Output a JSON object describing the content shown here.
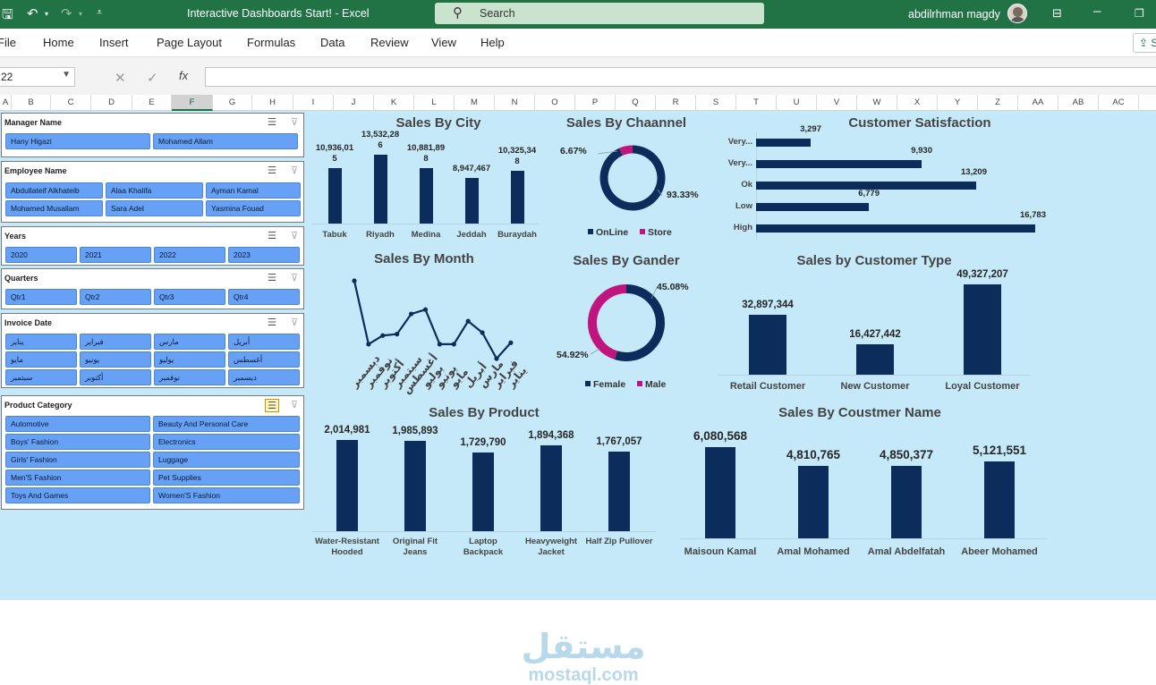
{
  "titlebar": {
    "doc_title": "Interactive Dashboards Start!  -  Excel",
    "search_placeholder": "Search",
    "user_name": "abdilrhman magdy",
    "accent_color": "#217346",
    "icons": [
      "save-icon",
      "undo-icon",
      "redo-icon",
      "customize-qat-icon",
      "ribbon-display-icon",
      "restore-icon"
    ]
  },
  "ribbon": {
    "tabs": [
      "File",
      "Home",
      "Insert",
      "Page Layout",
      "Formulas",
      "Data",
      "Review",
      "View",
      "Help"
    ],
    "share_label": "S"
  },
  "formula_bar": {
    "name_box": "22",
    "formula": ""
  },
  "columns": [
    "A",
    "B",
    "C",
    "D",
    "E",
    "F",
    "G",
    "H",
    "I",
    "J",
    "K",
    "L",
    "M",
    "N",
    "O",
    "P",
    "Q",
    "R",
    "S",
    "T",
    "U",
    "V",
    "W",
    "X",
    "Y",
    "Z",
    "AA",
    "AB",
    "AC"
  ],
  "selected_column": "F",
  "slicers": {
    "manager": {
      "title": "Manager Name",
      "items": [
        "Hany Higazi",
        "Mohamed Allam"
      ]
    },
    "employee": {
      "title": "Employee Name",
      "items": [
        "Abdullateif Alkhateib",
        "Alaa Khalifa",
        "Ayman Kamal",
        "Mohamed Musallam",
        "Sara Adel",
        "Yasmina Fouad"
      ]
    },
    "years": {
      "title": "Years",
      "items": [
        "2020",
        "2021",
        "2022",
        "2023"
      ]
    },
    "quarters": {
      "title": "Quarters",
      "items": [
        "Qtr1",
        "Qtr2",
        "Qtr3",
        "Qtr4"
      ]
    },
    "invoice_date": {
      "title": "Invoice Date",
      "items": [
        "يناير",
        "فبراير",
        "مارس",
        "أبريل",
        "مايو",
        "يونيو",
        "يوليو",
        "أغسطس",
        "سبتمبر",
        "أكتوبر",
        "نوفمبر",
        "ديسمبر"
      ]
    },
    "category": {
      "title": "Product Category",
      "items": [
        "Automotive",
        "Beauty And Personal Care",
        "Boys' Fashion",
        "Electronics",
        "Girls' Fashion",
        "Luggage",
        "Men'S Fashion",
        "Pet Supplies",
        "Toys And Games",
        "Women'S Fashion"
      ]
    }
  },
  "chart_data": [
    {
      "id": "city",
      "type": "bar",
      "title": "Sales By City",
      "categories": [
        "Tabuk",
        "Riyadh",
        "Medina",
        "Jeddah",
        "Buraydah"
      ],
      "values": [
        10936015,
        13532286,
        10881898,
        8947467,
        10325348
      ],
      "labels": [
        "10,936,01\n5",
        "13,532,28\n6",
        "10,881,89\n8",
        "8,947,467",
        "10,325,34\n8"
      ]
    },
    {
      "id": "channel",
      "type": "pie",
      "title": "Sales By Chaannel",
      "categories": [
        "OnLine",
        "Store"
      ],
      "values": [
        93.33,
        6.67
      ],
      "labels": [
        "93.33%",
        "6.67%"
      ],
      "colors": [
        "#0c2c5c",
        "#c0157f"
      ],
      "legend": "bottom"
    },
    {
      "id": "satisfaction",
      "type": "bar",
      "orientation": "horizontal",
      "title": "Customer Satisfaction",
      "categories": [
        "Very...",
        "Very...",
        "Ok",
        "Low",
        "High"
      ],
      "values": [
        3297,
        9930,
        13209,
        6779,
        16783
      ],
      "labels": [
        "3,297",
        "9,930",
        "13,209",
        "6,779",
        "16,783"
      ]
    },
    {
      "id": "month",
      "type": "line",
      "title": "Sales By Month",
      "categories": [
        "ديسمبر",
        "نوفمبر",
        "أكتوبر",
        "سبتمبر",
        "أغسطس",
        "يوليو",
        "يونيو",
        "مايو",
        "أبريل",
        "مارس",
        "فبراير",
        "يناير"
      ],
      "values": [
        9.0,
        4.6,
        5.2,
        5.3,
        6.7,
        7.0,
        4.6,
        4.6,
        6.2,
        5.4,
        3.6,
        4.7
      ]
    },
    {
      "id": "gender",
      "type": "pie",
      "title": "Sales By Gander",
      "categories": [
        "Female",
        "Male"
      ],
      "values": [
        54.92,
        45.08
      ],
      "labels": [
        "54.92%",
        "45.08%"
      ],
      "colors": [
        "#0c2c5c",
        "#c0157f"
      ],
      "legend": "bottom"
    },
    {
      "id": "customer_type",
      "type": "bar",
      "title": "Sales by Customer Type",
      "categories": [
        "Retail Customer",
        "New Customer",
        "Loyal Customer"
      ],
      "values": [
        32897344,
        16427442,
        49327207
      ],
      "labels": [
        "32,897,344",
        "16,427,442",
        "49,327,207"
      ]
    },
    {
      "id": "product",
      "type": "bar",
      "title": "Sales By Product",
      "categories": [
        "Water-Resistant Hooded",
        "Original Fit Jeans",
        "Laptop Backpack",
        "Heavyweight Jacket",
        "Half Zip Pullover"
      ],
      "values": [
        2014981,
        1985893,
        1729790,
        1894368,
        1767057
      ],
      "labels": [
        "2,014,981",
        "1,985,893",
        "1,729,790",
        "1,894,368",
        "1,767,057"
      ]
    },
    {
      "id": "customer_name",
      "type": "bar",
      "title": "Sales By Coustmer Name",
      "categories": [
        "Maisoun Kamal",
        "Amal Mohamed",
        "Amal Abdelfatah",
        "Abeer Mohamed"
      ],
      "values": [
        6080568,
        4810765,
        4850377,
        5121551
      ],
      "labels": [
        "6,080,568",
        "4,810,765",
        "4,850,377",
        "5,121,551"
      ]
    }
  ],
  "watermark": {
    "arabic": "مستقل",
    "latin": "mostaql.com"
  },
  "colors": {
    "sheet_bg": "#c5e9f8",
    "bar": "#0c2c5c",
    "accent2": "#c0157f",
    "slicer_button": "#66a1f5"
  }
}
